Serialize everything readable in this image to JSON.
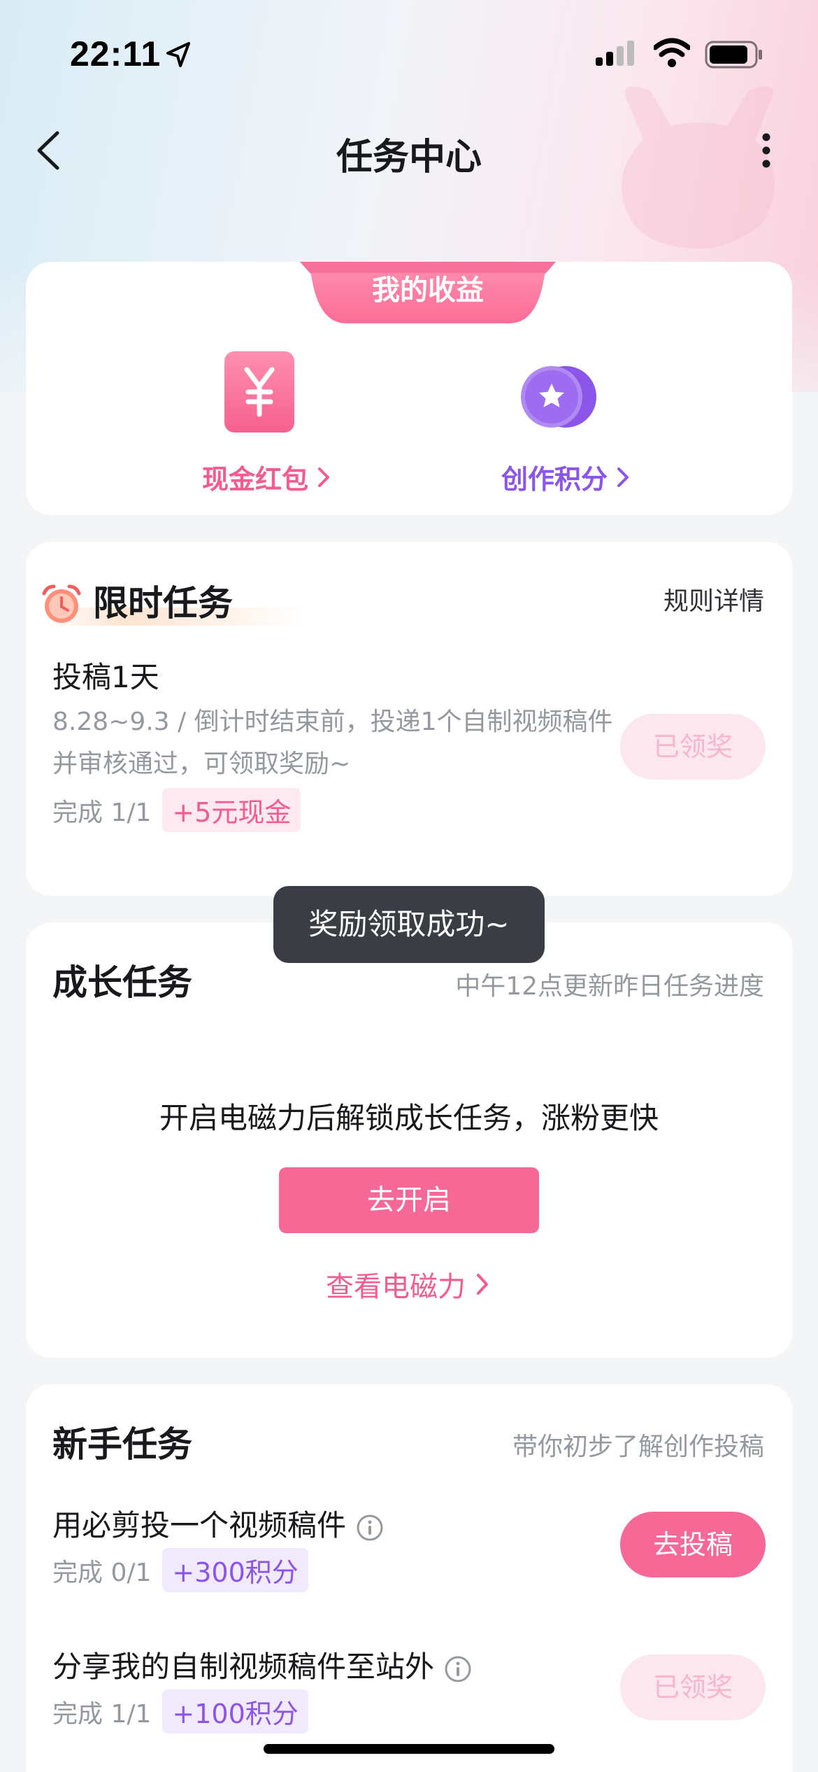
{
  "status_bar": {
    "time": "22:11"
  },
  "nav": {
    "title": "任务中心"
  },
  "earnings": {
    "title": "我的收益",
    "cash_label": "现金红包",
    "points_label": "创作积分",
    "cash_color": "#f25d8e",
    "points_color": "#8a55e8"
  },
  "limited": {
    "title": "限时任务",
    "rule_link": "规则详情",
    "task": {
      "name": "投稿1天",
      "desc": "8.28~9.3 / 倒计时结束前，投递1个自制视频稿件并审核通过，可领取奖励~",
      "progress": "完成 1/1",
      "reward": "+5元现金",
      "button": "已领奖"
    }
  },
  "growth": {
    "title": "成长任务",
    "subtitle": "中午12点更新昨日任务进度",
    "message": "开启电磁力后解锁成长任务，涨粉更快",
    "open_button": "去开启",
    "view_link": "查看电磁力"
  },
  "newbie": {
    "title": "新手任务",
    "subtitle": "带你初步了解创作投稿",
    "tasks": [
      {
        "name": "用必剪投一个视频稿件",
        "progress": "完成 0/1",
        "reward": "+300积分",
        "button": "去投稿"
      },
      {
        "name": "分享我的自制视频稿件至站外",
        "progress": "完成 1/1",
        "reward": "+100积分",
        "button": "已领奖"
      }
    ]
  },
  "toast": {
    "message": "奖励领取成功~"
  },
  "colors": {
    "accent_pink": "#f66997",
    "accent_purple": "#8a55e8"
  }
}
